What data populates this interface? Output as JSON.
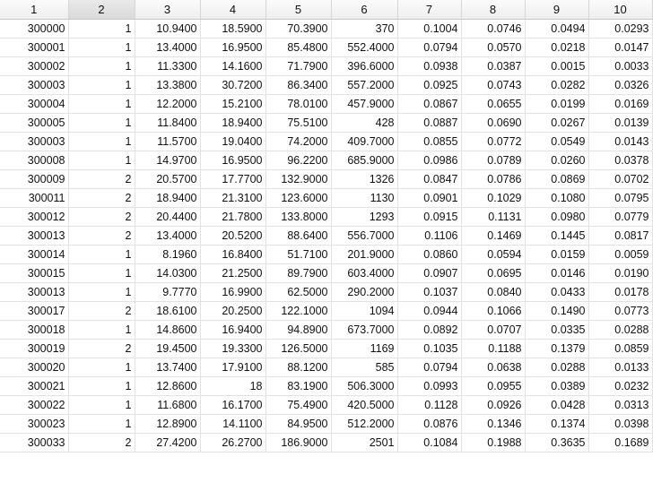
{
  "headers": [
    "1",
    "2",
    "3",
    "4",
    "5",
    "6",
    "7",
    "8",
    "9",
    "10"
  ],
  "selected_header_index": 1,
  "rows": [
    [
      "300000",
      "1",
      "10.9400",
      "18.5900",
      "70.3900",
      "370",
      "0.1004",
      "0.0746",
      "0.0494",
      "0.0293"
    ],
    [
      "300001",
      "1",
      "13.4000",
      "16.9500",
      "85.4800",
      "552.4000",
      "0.0794",
      "0.0570",
      "0.0218",
      "0.0147"
    ],
    [
      "300002",
      "1",
      "11.3300",
      "14.1600",
      "71.7900",
      "396.6000",
      "0.0938",
      "0.0387",
      "0.0015",
      "0.0033"
    ],
    [
      "300003",
      "1",
      "13.3800",
      "30.7200",
      "86.3400",
      "557.2000",
      "0.0925",
      "0.0743",
      "0.0282",
      "0.0326"
    ],
    [
      "300004",
      "1",
      "12.2000",
      "15.2100",
      "78.0100",
      "457.9000",
      "0.0867",
      "0.0655",
      "0.0199",
      "0.0169"
    ],
    [
      "300005",
      "1",
      "11.8400",
      "18.9400",
      "75.5100",
      "428",
      "0.0887",
      "0.0690",
      "0.0267",
      "0.0139"
    ],
    [
      "300003",
      "1",
      "11.5700",
      "19.0400",
      "74.2000",
      "409.7000",
      "0.0855",
      "0.0772",
      "0.0549",
      "0.0143"
    ],
    [
      "300008",
      "1",
      "14.9700",
      "16.9500",
      "96.2200",
      "685.9000",
      "0.0986",
      "0.0789",
      "0.0260",
      "0.0378"
    ],
    [
      "300009",
      "2",
      "20.5700",
      "17.7700",
      "132.9000",
      "1326",
      "0.0847",
      "0.0786",
      "0.0869",
      "0.0702"
    ],
    [
      "300011",
      "2",
      "18.9400",
      "21.3100",
      "123.6000",
      "1130",
      "0.0901",
      "0.1029",
      "0.1080",
      "0.0795"
    ],
    [
      "300012",
      "2",
      "20.4400",
      "21.7800",
      "133.8000",
      "1293",
      "0.0915",
      "0.1131",
      "0.0980",
      "0.0779"
    ],
    [
      "300013",
      "2",
      "13.4000",
      "20.5200",
      "88.6400",
      "556.7000",
      "0.1106",
      "0.1469",
      "0.1445",
      "0.0817"
    ],
    [
      "300014",
      "1",
      "8.1960",
      "16.8400",
      "51.7100",
      "201.9000",
      "0.0860",
      "0.0594",
      "0.0159",
      "0.0059"
    ],
    [
      "300015",
      "1",
      "14.0300",
      "21.2500",
      "89.7900",
      "603.4000",
      "0.0907",
      "0.0695",
      "0.0146",
      "0.0190"
    ],
    [
      "300013",
      "1",
      "9.7770",
      "16.9900",
      "62.5000",
      "290.2000",
      "0.1037",
      "0.0840",
      "0.0433",
      "0.0178"
    ],
    [
      "300017",
      "2",
      "18.6100",
      "20.2500",
      "122.1000",
      "1094",
      "0.0944",
      "0.1066",
      "0.1490",
      "0.0773"
    ],
    [
      "300018",
      "1",
      "14.8600",
      "16.9400",
      "94.8900",
      "673.7000",
      "0.0892",
      "0.0707",
      "0.0335",
      "0.0288"
    ],
    [
      "300019",
      "2",
      "19.4500",
      "19.3300",
      "126.5000",
      "1169",
      "0.1035",
      "0.1188",
      "0.1379",
      "0.0859"
    ],
    [
      "300020",
      "1",
      "13.7400",
      "17.9100",
      "88.1200",
      "585",
      "0.0794",
      "0.0638",
      "0.0288",
      "0.0133"
    ],
    [
      "300021",
      "1",
      "12.8600",
      "18",
      "83.1900",
      "506.3000",
      "0.0993",
      "0.0955",
      "0.0389",
      "0.0232"
    ],
    [
      "300022",
      "1",
      "11.6800",
      "16.1700",
      "75.4900",
      "420.5000",
      "0.1128",
      "0.0926",
      "0.0428",
      "0.0313"
    ],
    [
      "300023",
      "1",
      "12.8900",
      "14.1100",
      "84.9500",
      "512.2000",
      "0.0876",
      "0.1346",
      "0.1374",
      "0.0398"
    ],
    [
      "300033",
      "2",
      "27.4200",
      "26.2700",
      "186.9000",
      "2501",
      "0.1084",
      "0.1988",
      "0.3635",
      "0.1689"
    ]
  ]
}
